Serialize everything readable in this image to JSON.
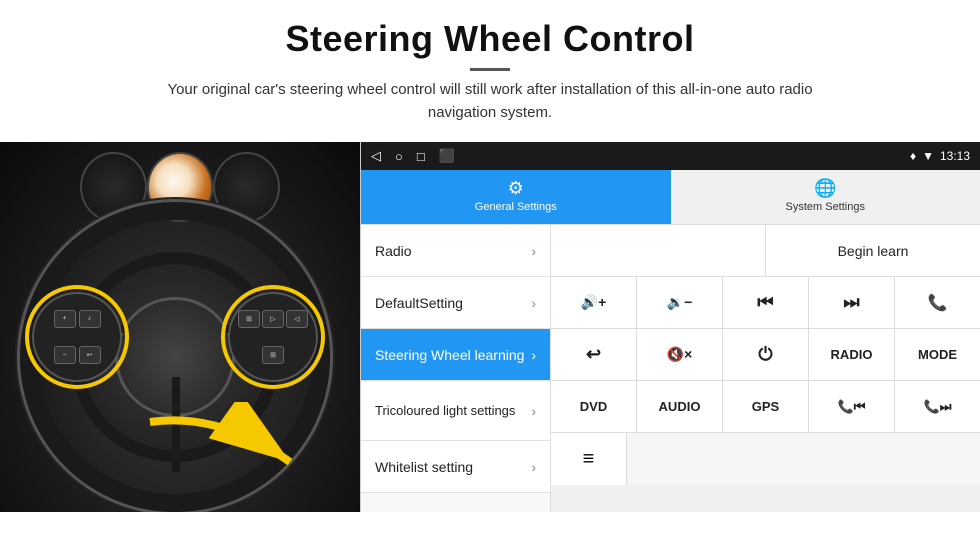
{
  "header": {
    "title": "Steering Wheel Control",
    "subtitle": "Your original car's steering wheel control will still work after installation of this all-in-one auto radio navigation system."
  },
  "status_bar": {
    "time": "13:13",
    "icons": [
      "◁",
      "○",
      "□",
      "⬛"
    ],
    "right_icons": [
      "♦",
      "▼"
    ]
  },
  "tabs": [
    {
      "id": "general",
      "label": "General Settings",
      "icon": "⚙",
      "active": true
    },
    {
      "id": "system",
      "label": "System Settings",
      "icon": "🌐",
      "active": false
    }
  ],
  "menu_items": [
    {
      "id": "radio",
      "label": "Radio",
      "active": false
    },
    {
      "id": "default",
      "label": "DefaultSetting",
      "active": false
    },
    {
      "id": "steering",
      "label": "Steering Wheel learning",
      "active": true
    },
    {
      "id": "tricoloured",
      "label": "Tricoloured light settings",
      "active": false
    },
    {
      "id": "whitelist",
      "label": "Whitelist setting",
      "active": false
    }
  ],
  "controls": {
    "begin_learn_label": "Begin learn",
    "row2": [
      {
        "id": "vol_up",
        "label": "🔊+",
        "type": "icon"
      },
      {
        "id": "vol_down",
        "label": "🔉−",
        "type": "icon"
      },
      {
        "id": "prev",
        "label": "⏮",
        "type": "icon"
      },
      {
        "id": "next",
        "label": "⏭",
        "type": "icon"
      },
      {
        "id": "phone",
        "label": "📞",
        "type": "icon"
      }
    ],
    "row3": [
      {
        "id": "back",
        "label": "↩",
        "type": "icon"
      },
      {
        "id": "mute",
        "label": "🔇×",
        "type": "icon"
      },
      {
        "id": "power",
        "label": "⏻",
        "type": "icon"
      },
      {
        "id": "radio_btn",
        "label": "RADIO",
        "type": "text"
      },
      {
        "id": "mode",
        "label": "MODE",
        "type": "text"
      }
    ],
    "row4": [
      {
        "id": "dvd",
        "label": "DVD",
        "type": "text"
      },
      {
        "id": "audio",
        "label": "AUDIO",
        "type": "text"
      },
      {
        "id": "gps",
        "label": "GPS",
        "type": "text"
      },
      {
        "id": "tel_prev",
        "label": "📞⏮",
        "type": "icon"
      },
      {
        "id": "tel_next",
        "label": "📞⏭",
        "type": "icon"
      }
    ],
    "row5_icon": "≡"
  }
}
